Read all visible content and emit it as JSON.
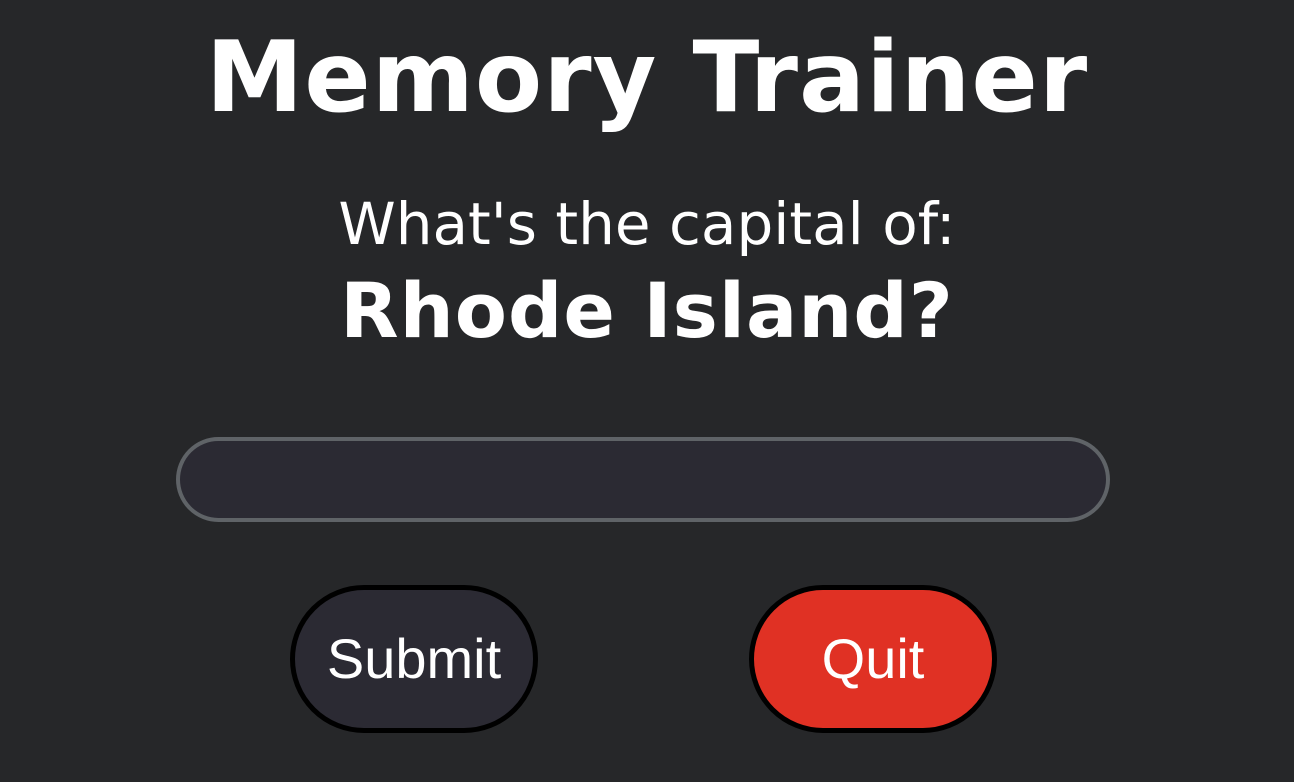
{
  "header": {
    "title": "Memory Trainer"
  },
  "quiz": {
    "prompt": "What's the capital of:",
    "question": "Rhode Island?"
  },
  "answer": {
    "value": "",
    "placeholder": ""
  },
  "actions": {
    "submit_label": "Submit",
    "quit_label": "Quit"
  },
  "colors": {
    "background": "#262729",
    "input_background": "#2b2a33",
    "input_border": "#5f6367",
    "quit_button": "#e03124",
    "text": "#ffffff"
  }
}
